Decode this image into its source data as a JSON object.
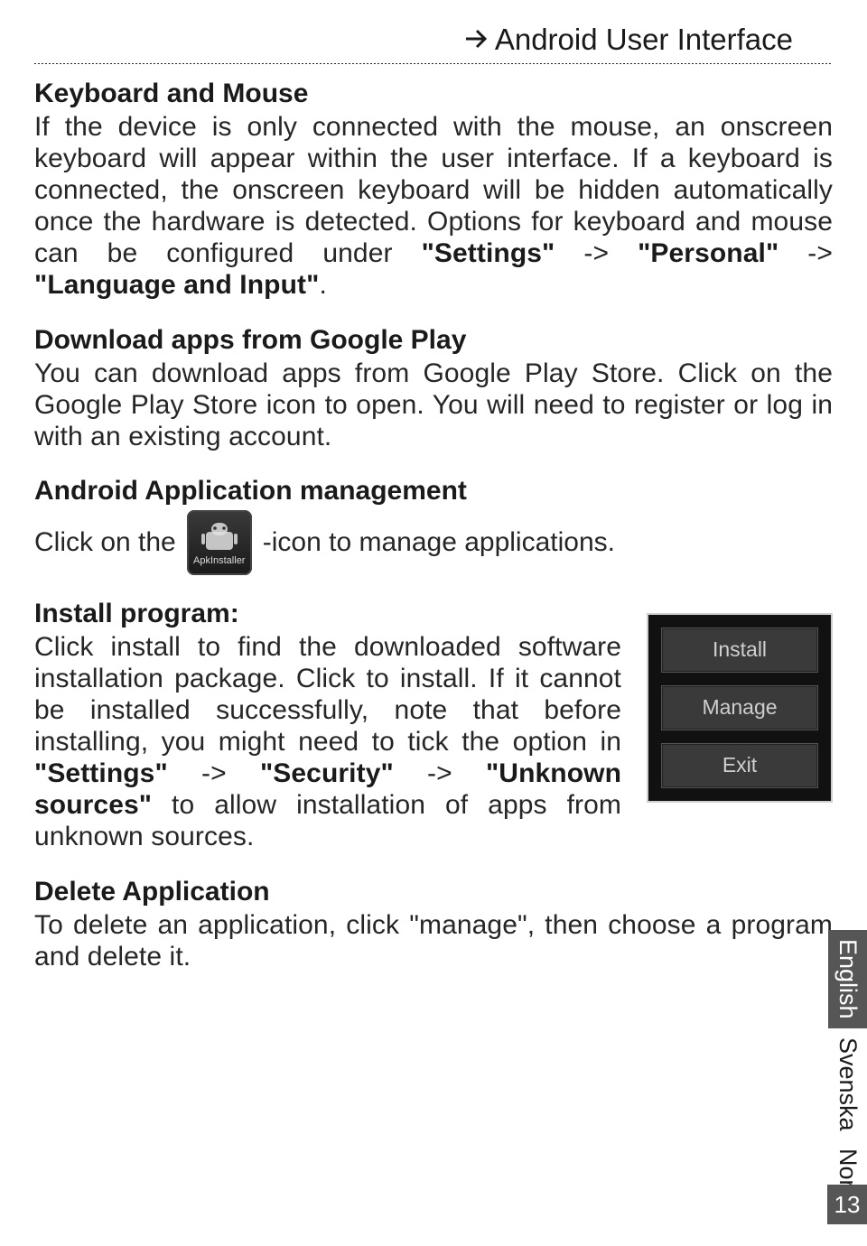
{
  "header": {
    "title": "Android User Interface"
  },
  "sections": {
    "keyboard": {
      "heading": "Keyboard and Mouse",
      "p1a": "If the device is only connected with the mouse, an onscreen keyboard will appear within the user interface. If a keyboard is connected, the onscreen keyboard will be hidden automatically once the hardware is detected. Options for keyboard and mouse can be configured under ",
      "b1": "\"Settings\"",
      "p1b": " -> ",
      "b2": "\"Personal\"",
      "p1c": " -> ",
      "b3": "\"Language and Input\"",
      "p1d": "."
    },
    "download": {
      "heading": "Download apps from Google Play",
      "p1": "You can download apps from Google Play Store. Click on the Google Play Store icon to open. You will need to register or log in with an existing account."
    },
    "appmgmt": {
      "heading": "Android Application management",
      "click_on_the": "Click on the",
      "after_icon": "-icon to manage applications.",
      "apk_label": "ApkInstaller"
    },
    "install": {
      "heading": "Install program:",
      "p1a": "Click install to find the downloaded software installation package. Click to install. If it cannot be installed successfully, note that before installing, you might need to tick the option in ",
      "b1": "\"Settings\"",
      "p1b": " -> ",
      "b2": "\"Security\"",
      "p1c": " -> ",
      "b3": "\"Unknown sources\"",
      "p1d": " to allow installation of apps from unknown sources."
    },
    "delete": {
      "heading": "Delete Application",
      "p1": "To delete an application, click \"manage\", then choose a program and delete it."
    }
  },
  "buttons": {
    "install": "Install",
    "manage": "Manage",
    "exit": "Exit"
  },
  "langs": {
    "english": "English",
    "svenska": "Svenska",
    "norsk": "Norsk"
  },
  "page_number": "13"
}
